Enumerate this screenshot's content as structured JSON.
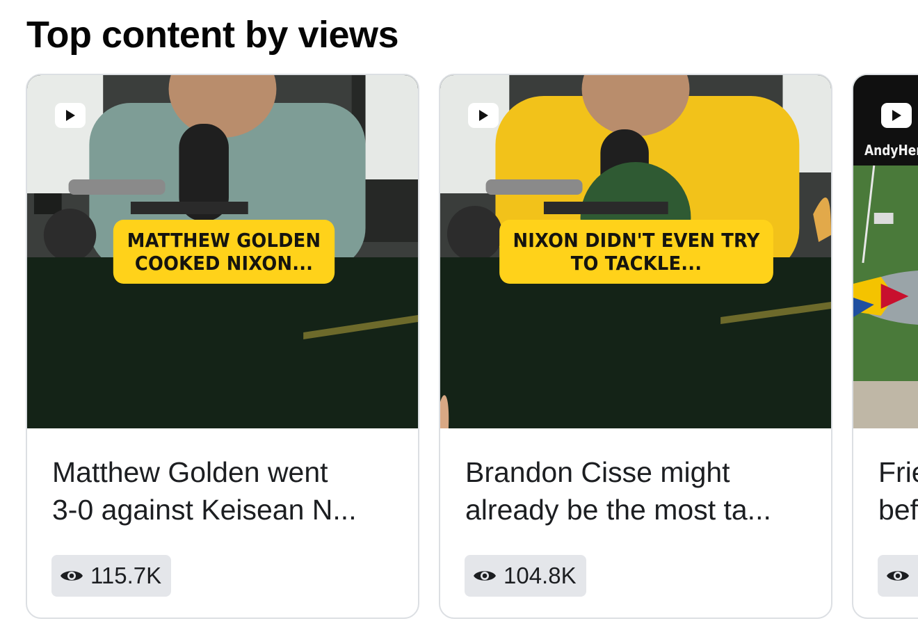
{
  "section": {
    "title": "Top content by views"
  },
  "cards": [
    {
      "caption_line1": "MATTHEW GOLDEN",
      "caption_line2": "COOKED NIXON...",
      "title_line1": "Matthew Golden went",
      "title_line2": "3-0 against Keisean N...",
      "views": "115.7K"
    },
    {
      "caption_line1": "NIXON DIDN'T EVEN TRY",
      "caption_line2": "TO TACKLE...",
      "title_line1": "Brandon Cisse might",
      "title_line2": "already be the most ta...",
      "views": "104.8K"
    },
    {
      "channel_tag": "AndyHer",
      "title_line1": "Frie",
      "title_line2": "bef",
      "views": ""
    }
  ],
  "icons": {
    "video": "play-icon",
    "views": "eye-icon"
  },
  "colors": {
    "caption_bg": "#ffd21a",
    "pill_bg": "#e4e6ea",
    "card_border": "#dcdfe3"
  }
}
